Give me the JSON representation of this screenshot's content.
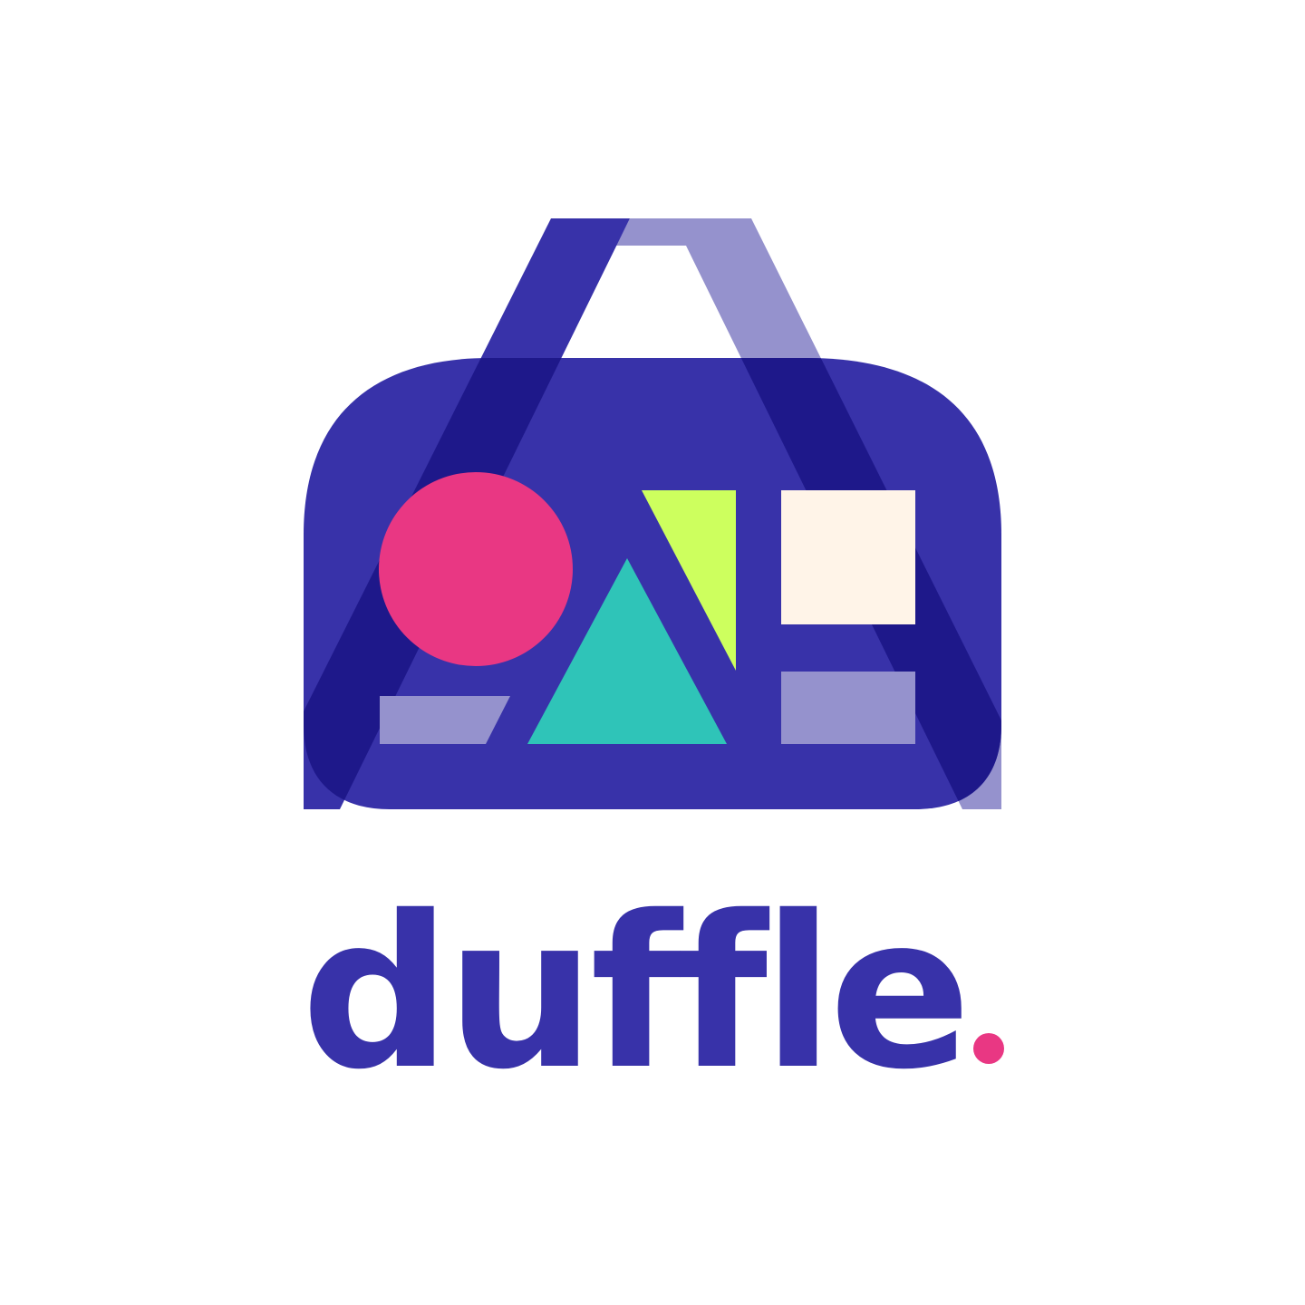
{
  "brand": {
    "name": "duffle",
    "dot_color": "#E93783",
    "text_color": "#3832A9"
  },
  "logo": {
    "icon_name": "duffle-bag-icon",
    "colors": {
      "bag_body": "#3832A9",
      "handle_front": "#3832A9",
      "handle_back": "#9592CD",
      "strap_overlap": "#1E188A",
      "circle": "#E93783",
      "triangle": "#2FC4B8",
      "wedge": "#CDFF5E",
      "square": "#FFF4E8",
      "bars": "#9592CD"
    }
  }
}
